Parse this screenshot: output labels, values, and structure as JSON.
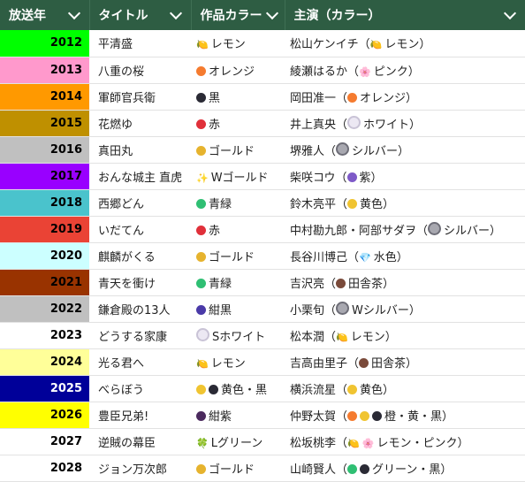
{
  "headers": [
    {
      "label": "放送年"
    },
    {
      "label": "タイトル"
    },
    {
      "label": "作品カラー"
    },
    {
      "label": "主演（カラー）"
    }
  ],
  "rows": [
    {
      "year": "2012",
      "year_bg": "#00ff00",
      "year_fg": "#000000",
      "title": "平清盛",
      "color_icons": [
        {
          "name": "lemon-icon",
          "glyph": "🍋",
          "color": "#f2d236"
        }
      ],
      "color": "レモン",
      "lead": "松山ケンイチ",
      "lead_icons": [
        {
          "name": "lemon-icon",
          "glyph": "🍋",
          "color": "#f2d236"
        }
      ],
      "lead_color": "レモン"
    },
    {
      "year": "2013",
      "year_bg": "#ff99cc",
      "year_fg": "#000000",
      "title": "八重の桜",
      "color_icons": [
        {
          "name": "orange-dot-icon",
          "color": "#f57b2f"
        }
      ],
      "color": "オレンジ",
      "lead": "綾瀬はるか",
      "lead_icons": [
        {
          "name": "sakura-icon",
          "glyph": "🌸",
          "color": "#f06b95"
        }
      ],
      "lead_color": "ピンク"
    },
    {
      "year": "2014",
      "year_bg": "#ff9900",
      "year_fg": "#000000",
      "title": "軍師官兵衛",
      "color_icons": [
        {
          "name": "black-dot-icon",
          "color": "#2a2a35"
        }
      ],
      "color": "黒",
      "lead": "岡田准一",
      "lead_icons": [
        {
          "name": "orange-dot-icon",
          "color": "#f57b2f"
        }
      ],
      "lead_color": "オレンジ"
    },
    {
      "year": "2015",
      "year_bg": "#bf9000",
      "year_fg": "#000000",
      "title": "花燃ゆ",
      "color_icons": [
        {
          "name": "red-dot-icon",
          "color": "#e0303a"
        }
      ],
      "color": "赤",
      "lead": "井上真央",
      "lead_icons": [
        {
          "name": "white-dot-icon",
          "color": "#ece8f3",
          "outline": "#c9c3d6"
        }
      ],
      "lead_color": "ホワイト"
    },
    {
      "year": "2016",
      "year_bg": "#c0c0c0",
      "year_fg": "#000000",
      "title": "真田丸",
      "color_icons": [
        {
          "name": "gold-dot-icon",
          "color": "#e6b32e"
        }
      ],
      "color": "ゴールド",
      "lead": "堺雅人",
      "lead_icons": [
        {
          "name": "silver-dot-icon",
          "color": "#a8a8b0",
          "outline": "#6e6e78"
        }
      ],
      "lead_color": "シルバー"
    },
    {
      "year": "2017",
      "year_bg": "#9900ff",
      "year_fg": "#000000",
      "title": "おんな城主 直虎",
      "color_icons": [
        {
          "name": "sparkle-icon",
          "glyph": "✨",
          "color": "#f3c024"
        }
      ],
      "color": "Wゴールド",
      "lead": "柴咲コウ",
      "lead_icons": [
        {
          "name": "purple-dot-icon",
          "color": "#7e5ac8"
        }
      ],
      "lead_color": "紫"
    },
    {
      "year": "2018",
      "year_bg": "#4ac3cc",
      "year_fg": "#000000",
      "title": "西郷どん",
      "color_icons": [
        {
          "name": "green-dot-icon",
          "color": "#2fbf73"
        }
      ],
      "color": "青緑",
      "lead": "鈴木亮平",
      "lead_icons": [
        {
          "name": "yellow-dot-icon",
          "color": "#f0c431"
        }
      ],
      "lead_color": "黄色"
    },
    {
      "year": "2019",
      "year_bg": "#ea4335",
      "year_fg": "#000000",
      "title": "いだてん",
      "color_icons": [
        {
          "name": "red-dot-icon",
          "color": "#e0303a"
        }
      ],
      "color": "赤",
      "lead": "中村勘九郎・阿部サダヲ",
      "lead_icons": [
        {
          "name": "silver-dot-icon",
          "color": "#a8a8b0",
          "outline": "#6e6e78"
        }
      ],
      "lead_color": "シルバー"
    },
    {
      "year": "2020",
      "year_bg": "#ccffff",
      "year_fg": "#000000",
      "title": "麒麟がくる",
      "color_icons": [
        {
          "name": "gold-dot-icon",
          "color": "#e6b32e"
        }
      ],
      "color": "ゴールド",
      "lead": "長谷川博己",
      "lead_icons": [
        {
          "name": "gem-icon",
          "glyph": "💎",
          "color": "#5bb6f0"
        }
      ],
      "lead_color": "水色"
    },
    {
      "year": "2021",
      "year_bg": "#993300",
      "year_fg": "#000000",
      "title": "青天を衝け",
      "color_icons": [
        {
          "name": "green-dot-icon",
          "color": "#2fbf73"
        }
      ],
      "color": "青緑",
      "lead": "吉沢亮",
      "lead_icons": [
        {
          "name": "brown-dot-icon",
          "color": "#7a4a3a"
        }
      ],
      "lead_color": "田舎茶"
    },
    {
      "year": "2022",
      "year_bg": "#c0c0c0",
      "year_fg": "#000000",
      "title": "鎌倉殿の13人",
      "color_icons": [
        {
          "name": "navy-wave-icon",
          "color": "#4a3aa8"
        }
      ],
      "color": "紺黒",
      "lead": "小栗旬",
      "lead_icons": [
        {
          "name": "silver-dot-icon",
          "color": "#a8a8b0",
          "outline": "#6e6e78"
        }
      ],
      "lead_color": "Wシルバー"
    },
    {
      "year": "2023",
      "year_bg": "#ffffff",
      "year_fg": "#000000",
      "title": "どうする家康",
      "color_icons": [
        {
          "name": "white-dot-icon",
          "color": "#ece8f3",
          "outline": "#c9c3d6"
        }
      ],
      "color": "Sホワイト",
      "lead": "松本潤",
      "lead_icons": [
        {
          "name": "lemon-icon",
          "glyph": "🍋",
          "color": "#f2d236"
        }
      ],
      "lead_color": "レモン"
    },
    {
      "year": "2024",
      "year_bg": "#ffff99",
      "year_fg": "#000000",
      "title": "光る君へ",
      "color_icons": [
        {
          "name": "lemon-icon",
          "glyph": "🍋",
          "color": "#f2d236"
        }
      ],
      "color": "レモン",
      "lead": "吉高由里子",
      "lead_icons": [
        {
          "name": "brown-dot-icon",
          "color": "#7a4a3a"
        }
      ],
      "lead_color": "田舎茶"
    },
    {
      "year": "2025",
      "year_bg": "#000099",
      "year_fg": "#ffffff",
      "title": "べらぼう",
      "color_icons": [
        {
          "name": "yellow-dot-icon",
          "color": "#f0c431"
        },
        {
          "name": "black-dot-icon",
          "color": "#2a2a35"
        }
      ],
      "color": "黄色・黒",
      "lead": "横浜流星",
      "lead_icons": [
        {
          "name": "yellow-dot-icon",
          "color": "#f0c431"
        }
      ],
      "lead_color": "黄色"
    },
    {
      "year": "2026",
      "year_bg": "#ffff00",
      "year_fg": "#000000",
      "title": "豊臣兄弟!",
      "color_icons": [
        {
          "name": "navy-purple-icon",
          "color": "#4b2a5e"
        }
      ],
      "color": "紺紫",
      "lead": "仲野太賀",
      "lead_icons": [
        {
          "name": "orange-dot-icon",
          "color": "#f57b2f"
        },
        {
          "name": "yellow-dot-icon",
          "color": "#f0c431"
        },
        {
          "name": "black-dot-icon",
          "color": "#2a2a35"
        }
      ],
      "lead_color": "橙・黄・黒"
    },
    {
      "year": "2027",
      "year_bg": "#ffffff",
      "year_fg": "#000000",
      "title": "逆賊の幕臣",
      "color_icons": [
        {
          "name": "clover-icon",
          "glyph": "🍀",
          "color": "#3aa85a"
        }
      ],
      "color": "Lグリーン",
      "lead": "松坂桃李",
      "lead_icons": [
        {
          "name": "lemon-icon",
          "glyph": "🍋",
          "color": "#f2d236"
        },
        {
          "name": "sakura-icon",
          "glyph": "🌸",
          "color": "#f06b95"
        }
      ],
      "lead_color": "レモン・ピンク"
    },
    {
      "year": "2028",
      "year_bg": "#ffffff",
      "year_fg": "#000000",
      "title": "ジョン万次郎",
      "color_icons": [
        {
          "name": "gold-dot-icon",
          "color": "#e6b32e"
        }
      ],
      "color": "ゴールド",
      "lead": "山崎賢人",
      "lead_icons": [
        {
          "name": "green-dot-icon",
          "color": "#2fbf73"
        },
        {
          "name": "black-dot-icon",
          "color": "#2a2a35"
        }
      ],
      "lead_color": "グリーン・黒"
    }
  ],
  "colors": {
    "header_bg": "#2e5d43",
    "header_fg": "#ffffff",
    "row_border": "#e2e2e2"
  }
}
